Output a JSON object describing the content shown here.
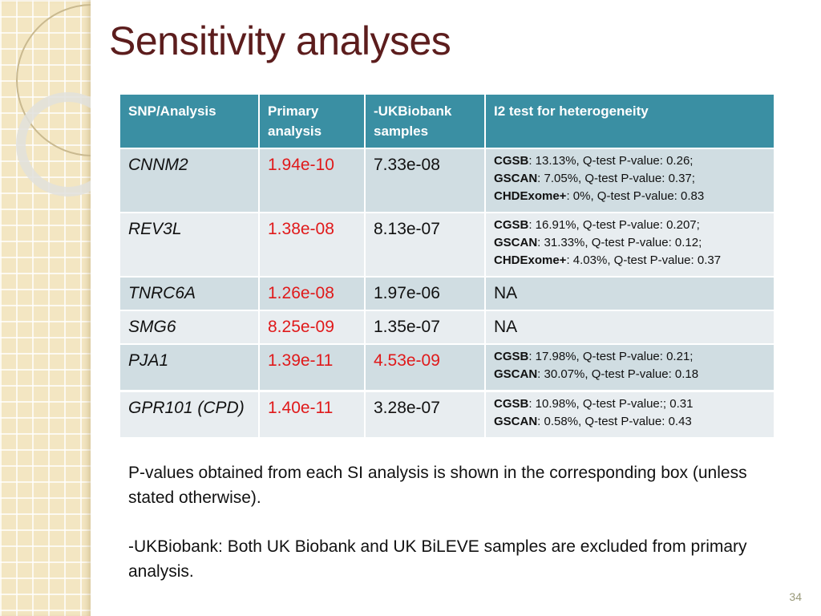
{
  "slide": {
    "title": "Sensitivity analyses",
    "page_number": "34"
  },
  "table": {
    "headers": [
      "SNP/Analysis",
      "Primary analysis",
      "-UKBiobank samples",
      "I2 test for heterogeneity"
    ],
    "rows": [
      {
        "snp": "CNNM2",
        "primary": "1.94e-10",
        "ukbiobank": "7.33e-08",
        "i2": [
          {
            "cohort": "CGSB",
            "text": ": 13.13%, Q-test P-value: 0.26;"
          },
          {
            "cohort": "GSCAN",
            "text": ": 7.05%, Q-test P-value: 0.37;"
          },
          {
            "cohort": "CHDExome+",
            "text": ": 0%, Q-test P-value: 0.83"
          }
        ]
      },
      {
        "snp": "REV3L",
        "primary": "1.38e-08",
        "ukbiobank": "8.13e-07",
        "i2": [
          {
            "cohort": "CGSB",
            "text": ": 16.91%, Q-test P-value: 0.207;"
          },
          {
            "cohort": "GSCAN",
            "text": ": 31.33%, Q-test P-value: 0.12;"
          },
          {
            "cohort": "CHDExome+",
            "text": ": 4.03%, Q-test P-value: 0.37"
          }
        ]
      },
      {
        "snp": "TNRC6A",
        "primary": "1.26e-08",
        "ukbiobank": "1.97e-06",
        "i2_na": "NA"
      },
      {
        "snp": "SMG6",
        "primary": "8.25e-09",
        "ukbiobank": "1.35e-07",
        "i2_na": "NA"
      },
      {
        "snp": "PJA1",
        "primary": "1.39e-11",
        "ukbiobank": "4.53e-09",
        "i2": [
          {
            "cohort": "CGSB",
            "text": ": 17.98%, Q-test P-value: 0.21;"
          },
          {
            "cohort": "GSCAN",
            "text": ": 30.07%, Q-test P-value: 0.18"
          }
        ]
      },
      {
        "snp": "GPR101 (CPD)",
        "primary": "1.40e-11",
        "ukbiobank": "3.28e-07",
        "i2": [
          {
            "cohort": "CGSB",
            "text": ": 10.98%, Q-test P-value:; 0.31"
          },
          {
            "cohort": "GSCAN",
            "text": ": 0.58%, Q-test P-value: 0.43"
          }
        ]
      }
    ],
    "colors": {
      "header_bg": "#3a8fa3",
      "significant": "#e0191a"
    }
  },
  "notes": [
    "P-values obtained from each SI analysis is shown in the corresponding box (unless stated otherwise).",
    "-UKBiobank: Both UK Biobank and UK BiLEVE samples are excluded from primary analysis."
  ]
}
